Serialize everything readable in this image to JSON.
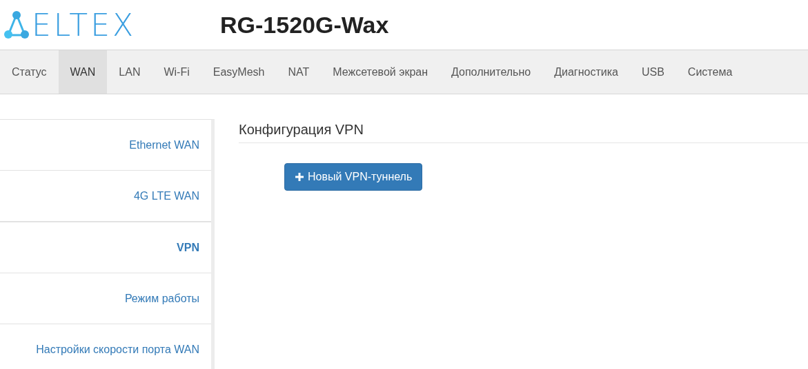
{
  "logo": {
    "text": "ELTEX"
  },
  "device_title": "RG-1520G-Wax",
  "tabs": [
    {
      "label": "Статус",
      "selected": false
    },
    {
      "label": "WAN",
      "selected": true
    },
    {
      "label": "LAN",
      "selected": false
    },
    {
      "label": "Wi-Fi",
      "selected": false
    },
    {
      "label": "EasyMesh",
      "selected": false
    },
    {
      "label": "NAT",
      "selected": false
    },
    {
      "label": "Межсетевой экран",
      "selected": false
    },
    {
      "label": "Дополнительно",
      "selected": false
    },
    {
      "label": "Диагностика",
      "selected": false
    },
    {
      "label": "USB",
      "selected": false
    },
    {
      "label": "Система",
      "selected": false
    }
  ],
  "sidebar": {
    "items": [
      {
        "label": "Ethernet WAN",
        "selected": false
      },
      {
        "label": "4G LTE WAN",
        "selected": false
      },
      {
        "label": "VPN",
        "selected": true
      },
      {
        "label": "Режим работы",
        "selected": false
      },
      {
        "label": "Настройки скорости порта WAN",
        "selected": false
      }
    ]
  },
  "content": {
    "heading": "Конфигурация VPN",
    "button": "Новый VPN-туннель"
  }
}
